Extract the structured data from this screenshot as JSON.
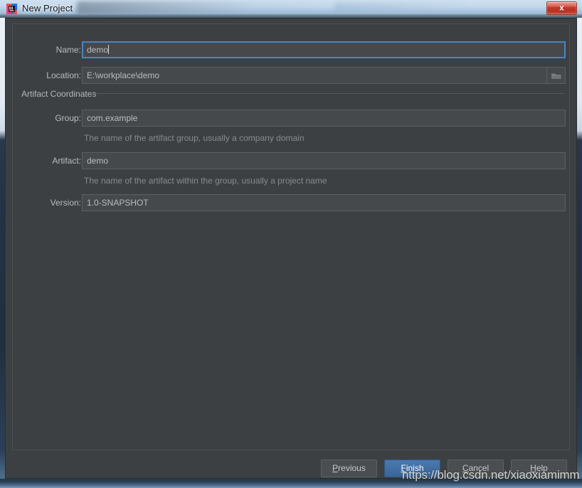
{
  "window": {
    "title": "New Project",
    "app_icon": "intellij-idea-icon",
    "close_label": "x"
  },
  "form": {
    "name": {
      "label": "Name:",
      "value": "demo",
      "focused": true
    },
    "location": {
      "label": "Location:",
      "value": "E:\\workplace\\demo",
      "browse_icon": "folder-icon"
    }
  },
  "artifact": {
    "section_title": "Artifact Coordinates",
    "group": {
      "label": "Group:",
      "value": "com.example",
      "hint": "The name of the artifact group, usually a company domain"
    },
    "artifact": {
      "label": "Artifact:",
      "value": "demo",
      "hint": "The name of the artifact within the group, usually a project name"
    },
    "version": {
      "label": "Version:",
      "value": "1.0-SNAPSHOT"
    }
  },
  "buttons": {
    "previous": {
      "prefix": "",
      "mnemonic": "P",
      "suffix": "revious"
    },
    "finish": {
      "prefix": "",
      "mnemonic": "F",
      "suffix": "inish"
    },
    "cancel": {
      "prefix": "",
      "mnemonic": "C",
      "suffix": "ancel"
    },
    "help": {
      "prefix": "",
      "mnemonic": "H",
      "suffix": "elp"
    }
  },
  "watermark": {
    "text": "https://blog.csdn.net/xiaoxiamimm"
  },
  "colors": {
    "dialog_bg": "#3c4043",
    "field_bg": "#45494c",
    "focus_border": "#4b84c4",
    "default_button": "#3a6496",
    "label_text": "#bbbbbb",
    "hint_text": "#868b8e"
  }
}
